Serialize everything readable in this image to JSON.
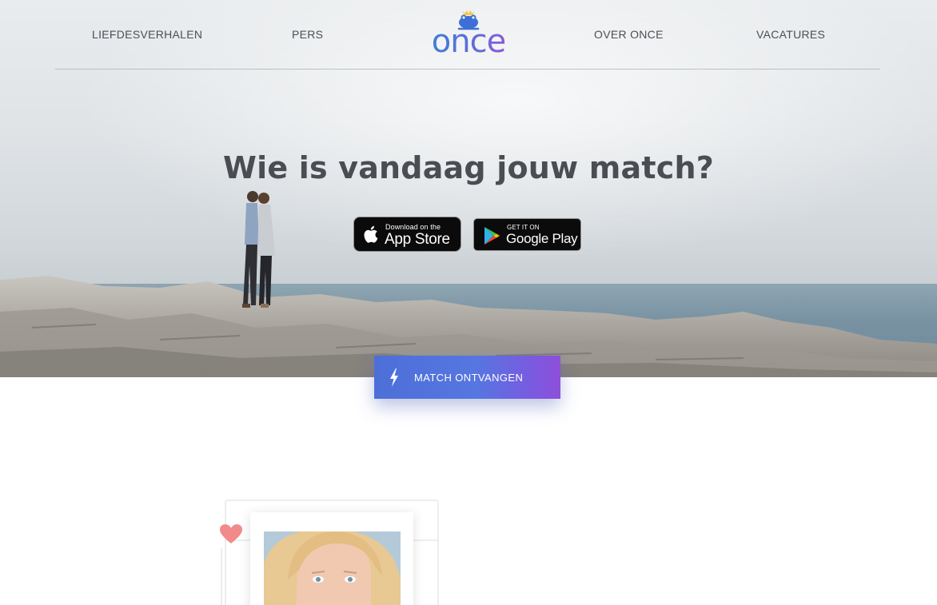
{
  "nav": {
    "links": [
      "LIEFDESVERHALEN",
      "PERS",
      "OVER ONCE",
      "VACATURES"
    ],
    "logo_text": "once"
  },
  "hero": {
    "headline": "Wie is vandaag jouw match?",
    "app_store": {
      "small": "Download on the",
      "big": "App Store"
    },
    "google_play": {
      "small": "GET IT ON",
      "big": "Google Play"
    }
  },
  "cta": {
    "label": "MATCH ONTVANGEN"
  },
  "colors": {
    "brand_blue": "#4d6fd8",
    "brand_purple": "#8e4fd8",
    "heart": "#f28a8a",
    "nav_text": "#4b4f55"
  },
  "icons": {
    "logo": "frog-crown-icon",
    "apple": "apple-icon",
    "google": "google-play-icon",
    "cta": "lightning-bolt-icon",
    "heart": "heart-icon"
  }
}
